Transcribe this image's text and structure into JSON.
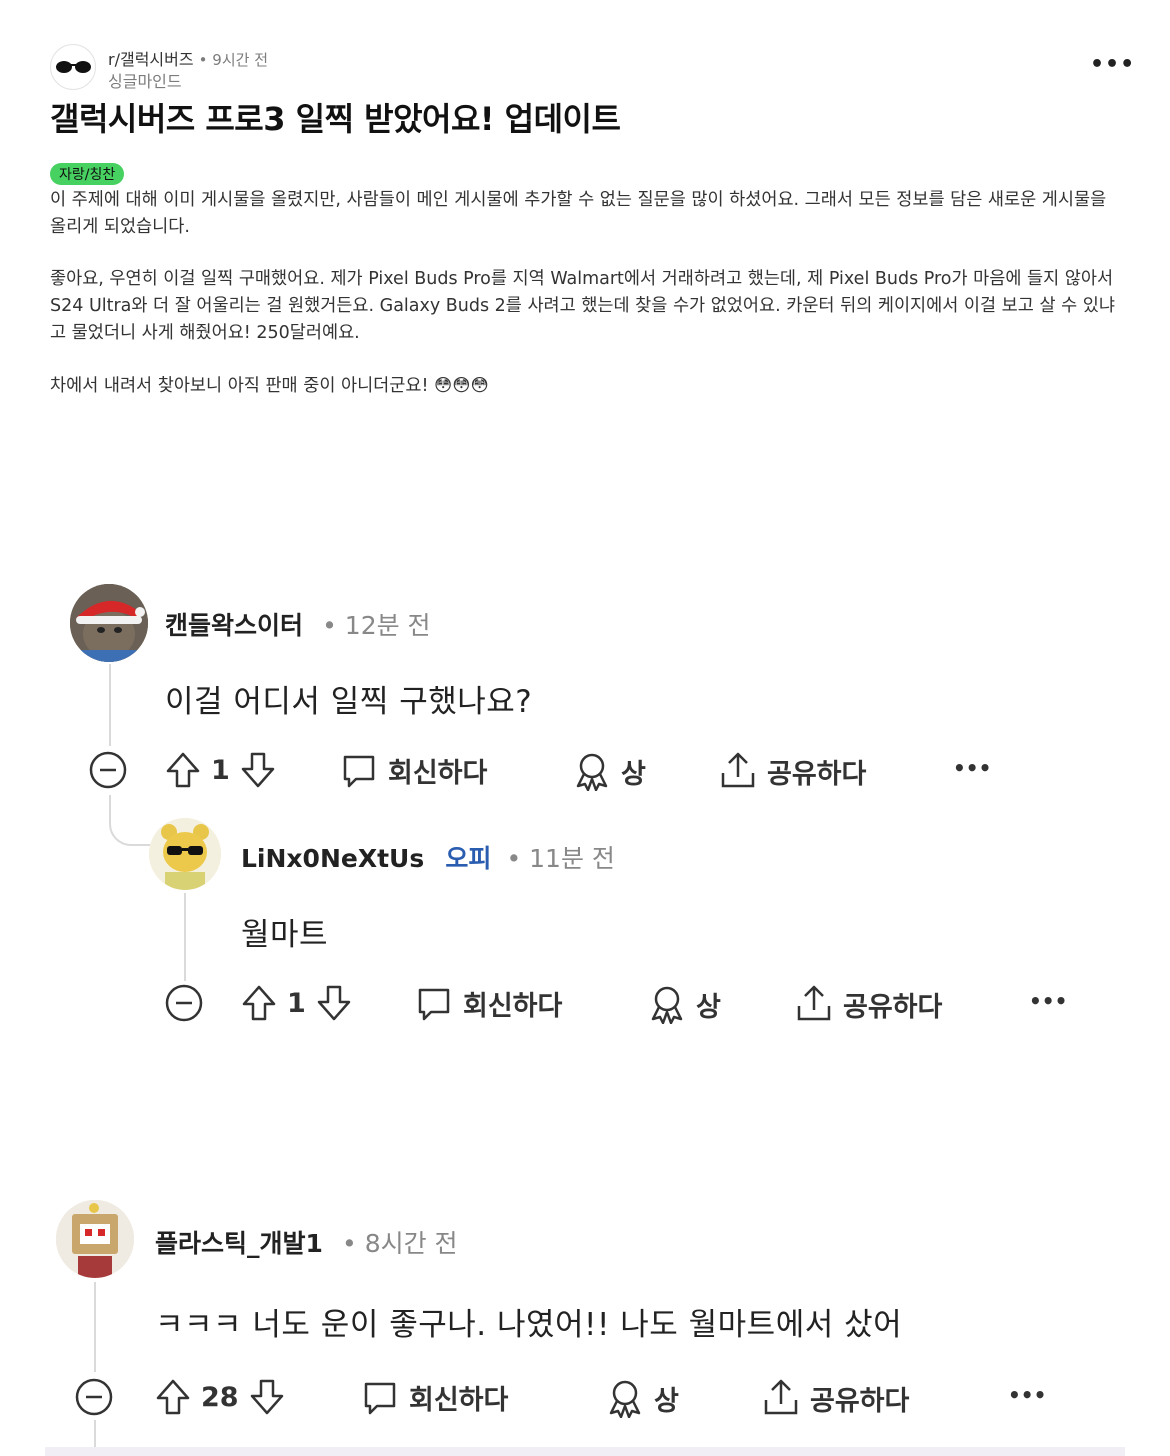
{
  "post": {
    "subreddit": "r/갤럭시버즈",
    "time": "• 9시간 전",
    "author": "싱글마인드",
    "more": "•••",
    "title": "갤럭시버즈 프로3 일찍 받았어요! 업데이트",
    "flair": "자랑/칭찬",
    "paragraphs": [
      "이 주제에 대해 이미 게시물을 올렸지만, 사람들이 메인 게시물에 추가할 수 없는 질문을 많이 하셨어요. 그래서 모든 정보를 담은 새로운 게시물을 올리게 되었습니다.",
      "좋아요, 우연히 이걸 일찍 구매했어요. 제가 Pixel Buds Pro를 지역 Walmart에서 거래하려고 했는데, 제 Pixel Buds Pro가 마음에 들지 않아서 S24 Ultra와 더 잘 어울리는 걸 원했거든요. Galaxy Buds 2를 사려고 했는데 찾을 수가 없었어요. 카운터 뒤의 케이지에서 이걸 보고 살 수 있냐고 물었더니 사게 해줬어요! 250달러예요.",
      "차에서 내려서 찾아보니 아직 판매 중이 아니더군요! 😳😳😳"
    ]
  },
  "comments": [
    {
      "username": "캔들왁스이터",
      "time": "• 12분 전",
      "text": "이걸 어디서 일찍 구했나요?",
      "votes": "1",
      "reply_label": "회신하다",
      "award_label": "상",
      "share_label": "공유하다",
      "more": "•••"
    },
    {
      "username": "LiNx0NeXtUs",
      "op_badge": "오피",
      "time": "• 11분 전",
      "text": "월마트",
      "votes": "1",
      "reply_label": "회신하다",
      "award_label": "상",
      "share_label": "공유하다",
      "more": "•••"
    },
    {
      "username": "플라스틱_개발1",
      "time": "• 8시간 전",
      "text": "ㅋㅋㅋ 너도 운이 좋구나. 나였어!! 나도 월마트에서 샀어",
      "votes": "28",
      "reply_label": "회신하다",
      "award_label": "상",
      "share_label": "공유하다",
      "more": "•••"
    }
  ],
  "colors": {
    "flair_bg": "#46d160",
    "op_badge": "#2a5db0",
    "meta_gray": "#888888"
  },
  "icons": [
    "collapse-icon",
    "upvote-icon",
    "downvote-icon",
    "reply-icon",
    "award-icon",
    "share-icon",
    "more-icon"
  ]
}
